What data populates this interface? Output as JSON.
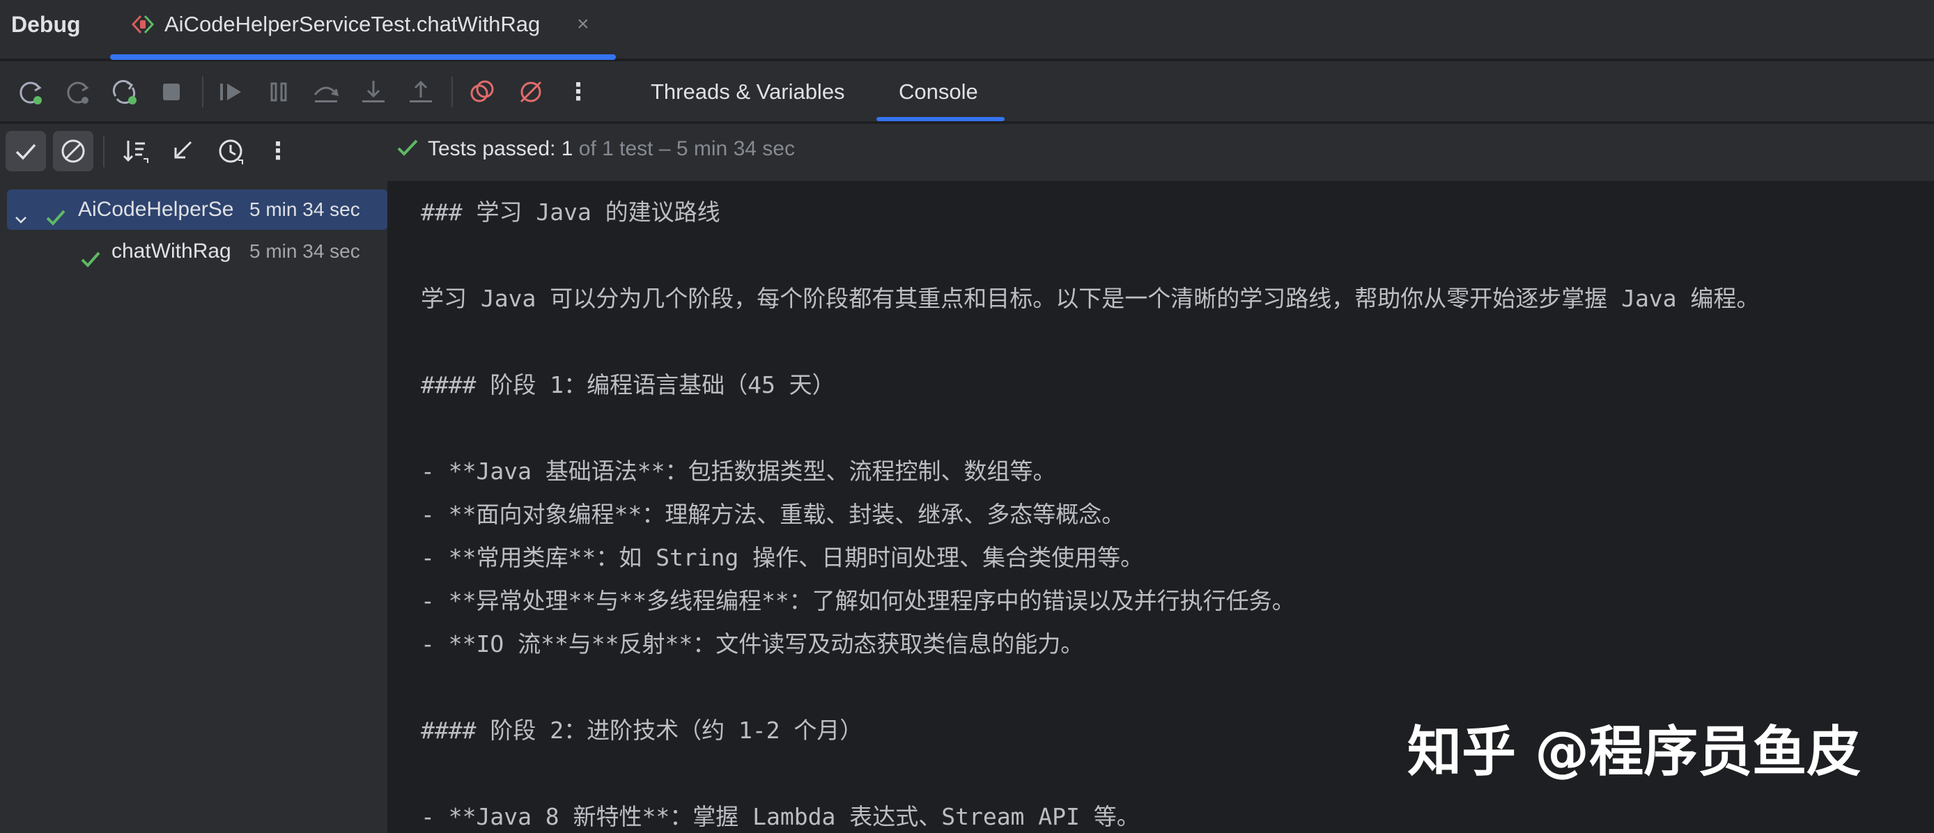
{
  "window": {
    "title": "Debug",
    "session_tab": "AiCodeHelperServiceTest.chatWithRag",
    "close_glyph": "×"
  },
  "toolbar": {
    "icons": [
      "rerun-icon",
      "rerun-failed-icon",
      "rerun-auto-icon",
      "stop-icon",
      "resume-icon",
      "pause-icon",
      "step-over-icon",
      "step-into-icon",
      "step-out-icon",
      "view-breakpoints-icon",
      "mute-breakpoints-icon",
      "more-icon"
    ],
    "tabs": [
      {
        "label": "Threads & Variables",
        "active": false
      },
      {
        "label": "Console",
        "active": true
      }
    ],
    "more_glyph": "⋮"
  },
  "runner": {
    "icons": [
      "show-passed-icon",
      "show-ignored-icon",
      "sort-icon",
      "collapse-icon",
      "history-icon",
      "more-icon"
    ],
    "status_passed": "Tests passed: 1",
    "status_rest": " of 1 test – 5 min 34 sec",
    "more_glyph": "⋮"
  },
  "tree": {
    "items": [
      {
        "name": "AiCodeHelperSe",
        "duration": "5 min 34 sec",
        "status": "passed",
        "selected": true,
        "expanded": true
      },
      {
        "name": "chatWithRag",
        "duration": "5 min 34 sec",
        "status": "passed",
        "selected": false
      }
    ]
  },
  "console": {
    "lines": [
      "### 学习 Java 的建议路线",
      "",
      "学习 Java 可以分为几个阶段，每个阶段都有其重点和目标。以下是一个清晰的学习路线，帮助你从零开始逐步掌握 Java 编程。",
      "",
      "#### 阶段 1：编程语言基础（45 天）",
      "",
      "- **Java 基础语法**：包括数据类型、流程控制、数组等。",
      "- **面向对象编程**：理解方法、重载、封装、继承、多态等概念。",
      "- **常用类库**：如 String 操作、日期时间处理、集合类使用等。",
      "- **异常处理**与**多线程编程**：了解如何处理程序中的错误以及并行执行任务。",
      "- **IO 流**与**反射**：文件读写及动态获取类信息的能力。",
      "",
      "#### 阶段 2：进阶技术（约 1-2 个月）",
      "",
      "- **Java 8 新特性**：掌握 Lambda 表达式、Stream API 等。"
    ]
  },
  "watermark": "知乎 @程序员鱼皮",
  "colors": {
    "accent": "#3574f0",
    "pass": "#5fb865",
    "panel": "#2b2d30",
    "editor": "#1e1f22",
    "selection": "#2e436e"
  }
}
